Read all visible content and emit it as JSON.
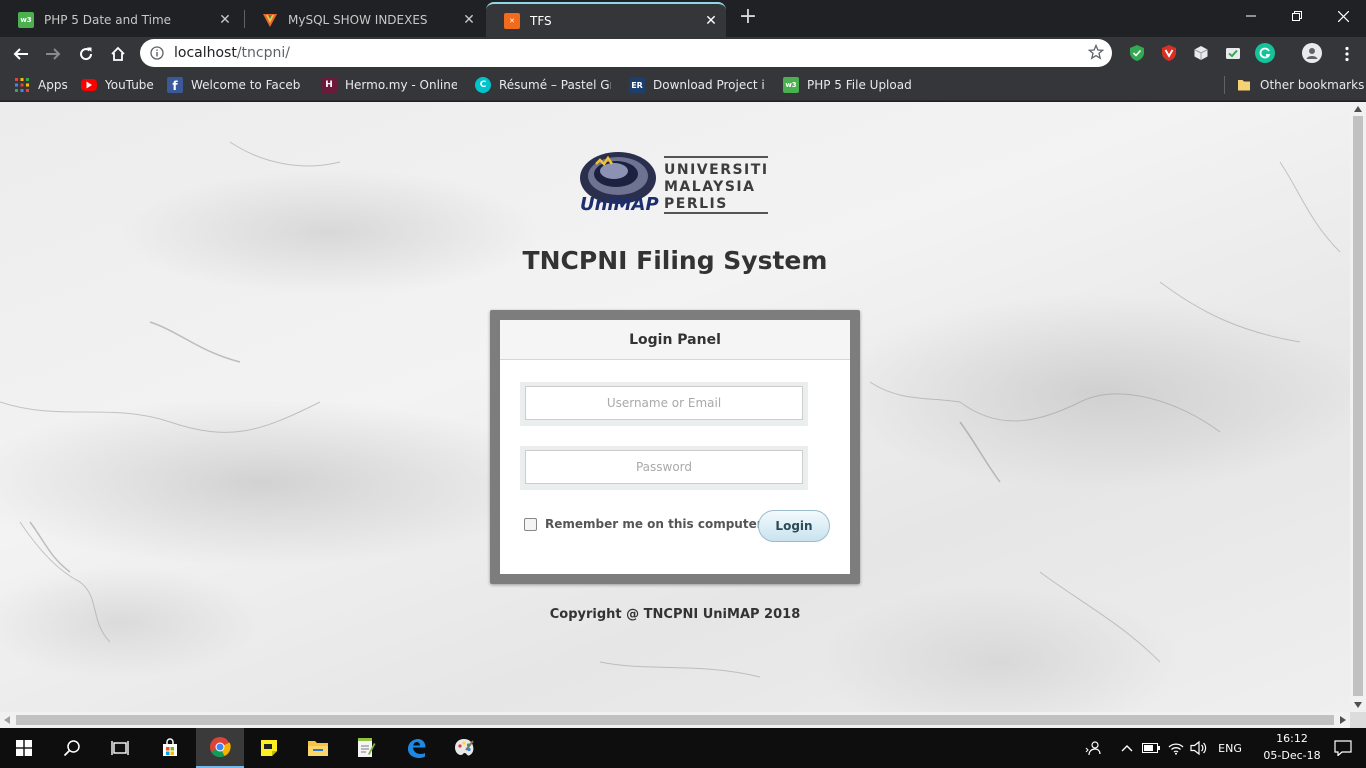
{
  "browser": {
    "tabs": [
      {
        "title": "PHP 5 Date and Time",
        "favicon": "w3schools-icon",
        "active": false
      },
      {
        "title": "MySQL SHOW INDEXES",
        "favicon": "mysql-icon",
        "active": false
      },
      {
        "title": "TFS",
        "favicon": "xampp-icon",
        "active": true
      }
    ],
    "url": {
      "host": "localhost",
      "path": "/tncpni/"
    },
    "bookmarks": [
      {
        "label": "Apps",
        "icon": "apps-grid-icon"
      },
      {
        "label": "YouTube",
        "icon": "youtube-icon"
      },
      {
        "label": "Welcome to Faceboo",
        "icon": "facebook-icon"
      },
      {
        "label": "Hermo.my - Online B",
        "icon": "hermo-icon"
      },
      {
        "label": "Résumé – Pastel Gree",
        "icon": "canva-icon"
      },
      {
        "label": "Download Project in",
        "icon": "er-icon"
      },
      {
        "label": "PHP 5 File Upload",
        "icon": "w3schools-icon"
      }
    ],
    "other_bookmarks": "Other bookmarks"
  },
  "page": {
    "logo": {
      "line1": "UNIVERSITI",
      "line2": "MALAYSIA",
      "line3": "PERLIS",
      "brand": "UniMAP"
    },
    "title": "TNCPNI Filing System",
    "login_panel": {
      "heading": "Login Panel",
      "username_placeholder": "Username or Email",
      "password_placeholder": "Password",
      "remember_label": "Remember me on this computer",
      "login_button": "Login"
    },
    "copyright": "Copyright @ TNCPNI UniMAP 2018"
  },
  "taskbar": {
    "apps": [
      "windows-start-icon",
      "search-icon",
      "task-view-icon",
      "store-icon",
      "chrome-icon",
      "sticky-notes-icon",
      "file-explorer-icon",
      "notepad-plus-plus-icon",
      "edge-icon",
      "paint-icon"
    ],
    "language": "ENG",
    "time": "16:12",
    "date": "05-Dec-18"
  }
}
